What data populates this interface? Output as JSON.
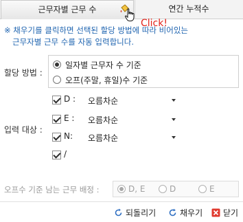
{
  "tabs": [
    {
      "label": "근무자별 근무 수"
    },
    {
      "label": "연간 누적수"
    }
  ],
  "annotation": {
    "click_text": "Click!"
  },
  "notice": {
    "line1": "※ 채우기를 클릭하면 선택된 할당 방법에 따라 비어있는",
    "line2": "근무자별 근무 수를 자동 입력합니다."
  },
  "method": {
    "label": "할당 방법 :",
    "options": [
      {
        "label": "일자별 근무자 수 기준",
        "checked": true
      },
      {
        "label": "오프(주말, 휴일)수 기준",
        "checked": false
      }
    ]
  },
  "targets": {
    "label": "입력 대상 :",
    "items": [
      {
        "code": "D :",
        "order": "오름차순",
        "checked": true
      },
      {
        "code": "E :",
        "order": "오름차순",
        "checked": true
      },
      {
        "code": "N:",
        "order": "오름차순",
        "checked": true
      },
      {
        "code": "/",
        "order": "",
        "checked": true
      }
    ]
  },
  "off_assign": {
    "label": "오프수 기준 남는 근무 배정 :",
    "options": [
      {
        "label": "D, E",
        "checked": true
      },
      {
        "label": "D",
        "checked": false
      },
      {
        "label": "E",
        "checked": false
      }
    ]
  },
  "buttons": {
    "revert": "되돌리기",
    "fill": "채우기",
    "close": "닫기"
  },
  "colors": {
    "notice_text": "#1f64b0",
    "click_text": "#e2231a",
    "close_icon": "#e03a2f",
    "refresh_icon": "#2f6fc2"
  }
}
